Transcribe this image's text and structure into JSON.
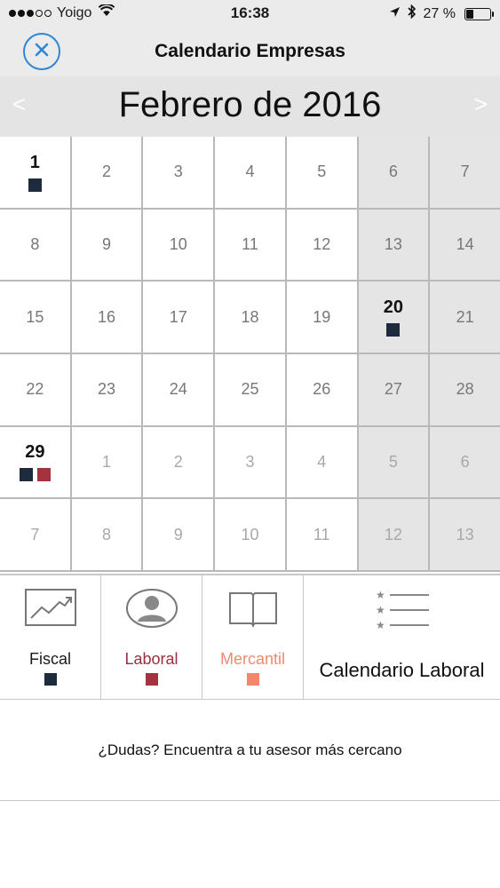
{
  "status_bar": {
    "carrier": "Yoigo",
    "time": "16:38",
    "battery": "27 %",
    "battery_level": 0.27,
    "signal_bars": 3,
    "signal_total": 5,
    "icons": [
      "wifi-icon",
      "location-arrow-icon",
      "bluetooth-icon",
      "battery-icon"
    ]
  },
  "nav": {
    "title": "Calendario Empresas",
    "close_icon": "close-icon",
    "accent": "#2f86d6"
  },
  "month": {
    "prev": "<",
    "next": ">",
    "title": "Febrero de 2016"
  },
  "weeks": [
    [
      {
        "day": "1",
        "markers": [
          "fiscal"
        ]
      },
      {
        "day": "2"
      },
      {
        "day": "3"
      },
      {
        "day": "4"
      },
      {
        "day": "5"
      },
      {
        "day": "6",
        "weekend": true
      },
      {
        "day": "7",
        "weekend": true
      }
    ],
    [
      {
        "day": "8"
      },
      {
        "day": "9"
      },
      {
        "day": "10"
      },
      {
        "day": "11"
      },
      {
        "day": "12"
      },
      {
        "day": "13",
        "weekend": true
      },
      {
        "day": "14",
        "weekend": true
      }
    ],
    [
      {
        "day": "15"
      },
      {
        "day": "16"
      },
      {
        "day": "17"
      },
      {
        "day": "18"
      },
      {
        "day": "19"
      },
      {
        "day": "20",
        "weekend": true,
        "markers": [
          "fiscal"
        ]
      },
      {
        "day": "21",
        "weekend": true
      }
    ],
    [
      {
        "day": "22"
      },
      {
        "day": "23"
      },
      {
        "day": "24"
      },
      {
        "day": "25"
      },
      {
        "day": "26"
      },
      {
        "day": "27",
        "weekend": true
      },
      {
        "day": "28",
        "weekend": true
      }
    ],
    [
      {
        "day": "29",
        "markers": [
          "fiscal",
          "laboral"
        ]
      },
      {
        "day": "1",
        "other": true
      },
      {
        "day": "2",
        "other": true
      },
      {
        "day": "3",
        "other": true
      },
      {
        "day": "4",
        "other": true
      },
      {
        "day": "5",
        "other": true,
        "weekend": true
      },
      {
        "day": "6",
        "other": true,
        "weekend": true
      }
    ],
    [
      {
        "day": "7",
        "other": true
      },
      {
        "day": "8",
        "other": true
      },
      {
        "day": "9",
        "other": true
      },
      {
        "day": "10",
        "other": true
      },
      {
        "day": "11",
        "other": true
      },
      {
        "day": "12",
        "other": true,
        "weekend": true
      },
      {
        "day": "13",
        "other": true,
        "weekend": true
      }
    ]
  ],
  "categories": [
    {
      "id": "fiscal",
      "label": "Fiscal",
      "icon": "chart-trend-icon",
      "text_color": "#1a1a1a",
      "color": "#1e2b3c"
    },
    {
      "id": "laboral",
      "label": "Laboral",
      "icon": "person-avatar-icon",
      "text_color": "#9b2f3d",
      "color": "#a3333f"
    },
    {
      "id": "mercantil",
      "label": "Mercantil",
      "icon": "open-book-icon",
      "text_color": "#ef8a6f",
      "color": "#f4876b"
    }
  ],
  "laboral_calendar": {
    "label": "Calendario Laboral",
    "icon": "star-list-icon"
  },
  "footer": {
    "advisor_text": "¿Dudas? Encuentra a tu asesor más cercano"
  }
}
